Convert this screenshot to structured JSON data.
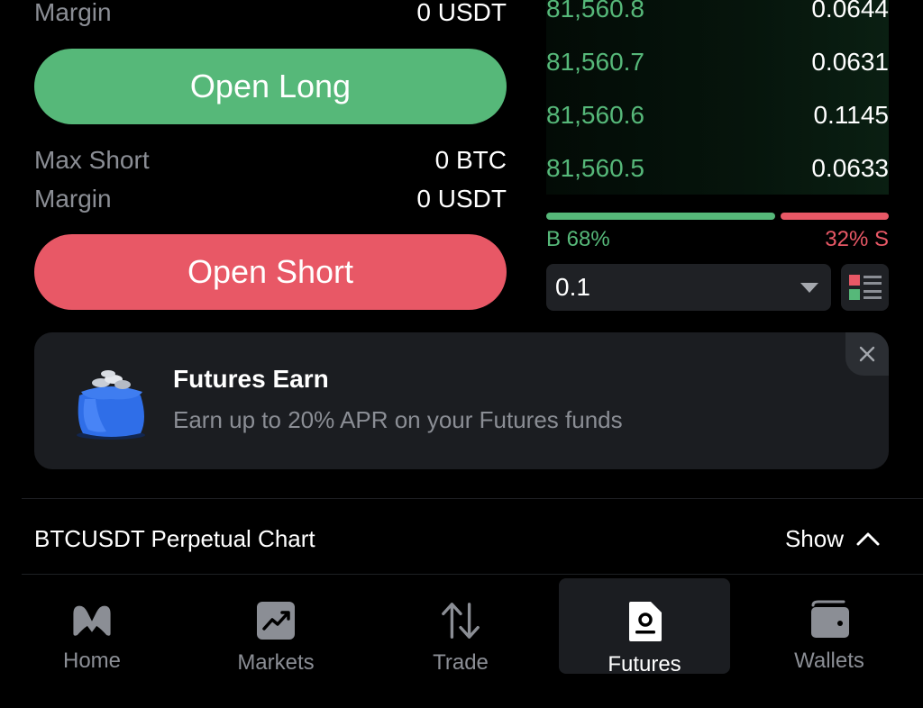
{
  "order_form": {
    "margin_top_label": "Margin",
    "margin_top_value": "0 USDT",
    "open_long_label": "Open Long",
    "max_short_label": "Max Short",
    "max_short_value": "0 BTC",
    "margin_label": "Margin",
    "margin_value": "0 USDT",
    "open_short_label": "Open Short"
  },
  "order_book": {
    "rows": [
      {
        "price": "81,560.8",
        "qty": "0.0644"
      },
      {
        "price": "81,560.7",
        "qty": "0.0631"
      },
      {
        "price": "81,560.6",
        "qty": "0.1145"
      },
      {
        "price": "81,560.5",
        "qty": "0.0633"
      }
    ],
    "buy_ratio": 68,
    "sell_ratio": 32,
    "buy_label": "B 68%",
    "sell_label": "32% S",
    "depth_value": "0.1",
    "layout_icon": "orderbook-layout-icon"
  },
  "banner": {
    "title": "Futures Earn",
    "subtitle": "Earn up to 20% APR on your Futures funds",
    "icon": "money-bag-icon"
  },
  "chart_section": {
    "title": "BTCUSDT Perpetual Chart",
    "toggle_label": "Show"
  },
  "bottom_nav": {
    "items": [
      {
        "label": "Home",
        "icon": "home-logo-icon",
        "active": false
      },
      {
        "label": "Markets",
        "icon": "markets-chart-icon",
        "active": false
      },
      {
        "label": "Trade",
        "icon": "trade-arrows-icon",
        "active": false
      },
      {
        "label": "Futures",
        "icon": "futures-document-icon",
        "active": true
      },
      {
        "label": "Wallets",
        "icon": "wallet-icon",
        "active": false
      }
    ]
  },
  "colors": {
    "buy": "#56b879",
    "sell": "#e85866",
    "background": "#000000",
    "card": "#1b1d21",
    "muted_text": "#8b8e95"
  }
}
